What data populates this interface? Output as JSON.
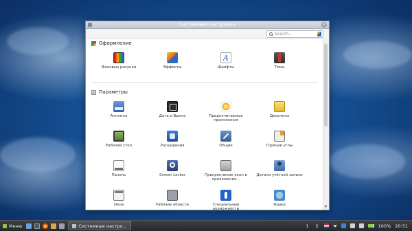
{
  "window": {
    "title": "Системные настройки",
    "search_placeholder": "Search..."
  },
  "appearance": {
    "title": "Оформление",
    "items": [
      {
        "label": "Фоновые рисунки",
        "icon": "wallpaper-icon"
      },
      {
        "label": "Эффекты",
        "icon": "effects-icon"
      },
      {
        "label": "Шрифты",
        "icon": "fonts-icon",
        "glyph": "A"
      },
      {
        "label": "Темы",
        "icon": "themes-icon"
      }
    ]
  },
  "preferences": {
    "title": "Параметры",
    "items": [
      {
        "label": "Апплеты",
        "icon": "applets-icon"
      },
      {
        "label": "Дата и Время",
        "icon": "date-time-icon"
      },
      {
        "label": "Предпочитаемые приложения",
        "icon": "preferred-apps-icon"
      },
      {
        "label": "Десклеты",
        "icon": "desklets-icon"
      },
      {
        "label": "Рабочий стол",
        "icon": "desktop-icon"
      },
      {
        "label": "Расширения",
        "icon": "extensions-icon"
      },
      {
        "label": "Общие",
        "icon": "general-icon"
      },
      {
        "label": "Горячие углы",
        "icon": "hot-corners-icon"
      },
      {
        "label": "Панель",
        "icon": "panel-icon"
      },
      {
        "label": "Screen Locker",
        "icon": "screen-locker-icon"
      },
      {
        "label": "Прикрепление окон и приложения...",
        "icon": "window-snapping-icon"
      },
      {
        "label": "Детали учётной записи",
        "icon": "account-details-icon"
      },
      {
        "label": "Окна",
        "icon": "windows-icon"
      },
      {
        "label": "Рабочие области",
        "icon": "workspaces-icon"
      },
      {
        "label": "Специальные возможности",
        "icon": "accessibility-icon"
      },
      {
        "label": "Языки",
        "icon": "languages-icon"
      }
    ]
  },
  "taskbar": {
    "menu_label": "Меню",
    "window_label": "Системные настро...",
    "workspace_1": "1",
    "workspace_2": "2",
    "battery": "100%",
    "time": "20:51"
  },
  "colors": {
    "window_bg": "#ffffff",
    "taskbar_bg": "#2d3034",
    "desktop_blue": "#154f93"
  }
}
